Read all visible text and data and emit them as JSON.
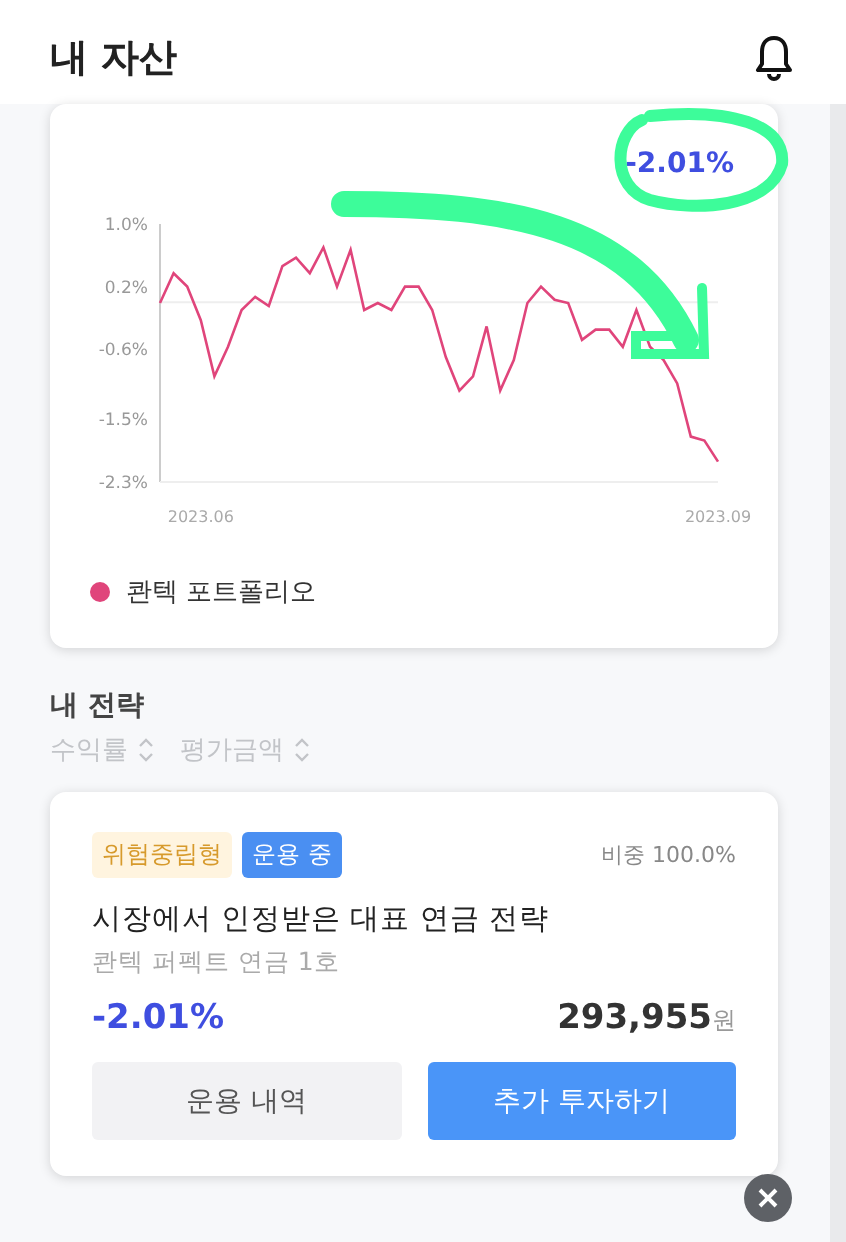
{
  "header": {
    "title": "내 자산"
  },
  "summary_card": {
    "return": "-2.01%",
    "chart_data": {
      "type": "line",
      "categories": [
        null,
        null,
        null,
        "2023.06",
        null,
        null,
        null,
        null,
        null,
        null,
        null,
        null,
        null,
        null,
        null,
        null,
        null,
        null,
        null,
        null,
        null,
        null,
        null,
        null,
        null,
        null,
        null,
        null,
        null,
        null,
        null,
        null,
        null,
        null,
        null,
        null,
        null,
        null,
        null,
        null,
        null,
        "2023.09"
      ],
      "ylim": [
        -2.3,
        1.0
      ],
      "yticks": [
        {
          "value": 1.0,
          "label": "1.0%"
        },
        {
          "value": 0.2,
          "label": "0.2%"
        },
        {
          "value": -0.6,
          "label": "-0.6%"
        },
        {
          "value": -1.5,
          "label": "-1.5%"
        },
        {
          "value": -2.3,
          "label": "-2.3%"
        }
      ],
      "series": [
        {
          "name": "콴텍 포트폴리오",
          "color": "#e0457b",
          "values": [
            -0.01,
            0.37,
            0.2,
            -0.23,
            -0.95,
            -0.57,
            -0.1,
            0.07,
            -0.05,
            0.46,
            0.57,
            0.37,
            0.7,
            0.2,
            0.67,
            -0.1,
            -0.01,
            -0.1,
            0.2,
            0.2,
            -0.1,
            -0.7,
            -1.13,
            -0.95,
            -0.31,
            -1.13,
            -0.74,
            -0.01,
            0.2,
            0.03,
            -0.01,
            -0.48,
            -0.35,
            -0.35,
            -0.57,
            -0.1,
            -0.57,
            -0.74,
            -1.04,
            -1.72,
            -1.77,
            -2.04
          ]
        }
      ]
    }
  },
  "strategy_section": {
    "title": "내 전략",
    "sort_options": [
      "수익률",
      "평가금액"
    ],
    "strategies": [
      {
        "risk_tag": "위험중립형",
        "status_tag": "운용 중",
        "weight": "비중 100.0%",
        "title": "시장에서 인정받은 대표 연금 전략",
        "subtitle": "콴텍 퍼펙트 연금 1호",
        "return": "-2.01%",
        "amount": "293,955",
        "unit": "원",
        "buttons": [
          {
            "label": "운용 내역",
            "kind": "secondary"
          },
          {
            "label": "추가 투자하기",
            "kind": "primary"
          }
        ]
      }
    ]
  }
}
